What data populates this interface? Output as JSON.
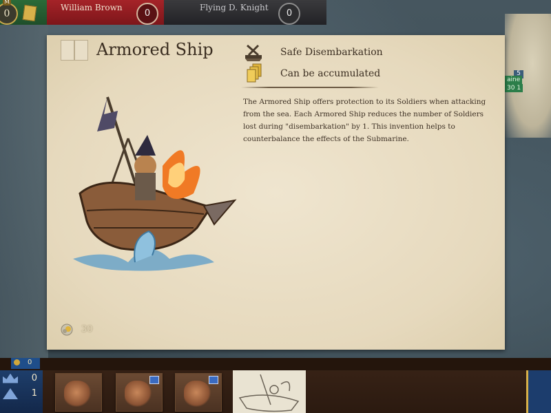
{
  "top_bar": {
    "resource_badge_letter": "M",
    "resource_count": "0",
    "players": [
      {
        "name": "William Brown",
        "score": "0",
        "color": "#a52328"
      },
      {
        "name": "Flying D. Knight",
        "score": "0",
        "color": "#2d2d2f"
      }
    ]
  },
  "map": {
    "region_name": "aine",
    "region_values": "30 1",
    "region_badge": "5"
  },
  "card": {
    "title": "Armored Ship",
    "abilities": [
      {
        "icon": "crossed-swords-icon",
        "label": "Safe Disembarkation"
      },
      {
        "icon": "stacked-cards-icon",
        "label": "Can be accumulated"
      }
    ],
    "description": "The Armored Ship offers protection to its Soldiers when attacking from the sea. Each Armored Ship reduces the number of Soldiers lost during \"disembarkation\" by 1. This invention helps to counterbalance the effects of the Submarine.",
    "cost_icon": "gear-coin-icon",
    "cost": "30"
  },
  "bottom_bar": {
    "top_tag_value": "0",
    "stats": [
      {
        "icon": "crown-icon",
        "value": "0"
      },
      {
        "icon": "soldier-icon",
        "value": "1"
      }
    ],
    "hand_cards": [
      {
        "name": "hand-card-1"
      },
      {
        "name": "hand-card-2"
      },
      {
        "name": "hand-card-3"
      }
    ]
  },
  "colors": {
    "parchment": "#e6d9bd",
    "text_dark": "#3a2d20",
    "player_red": "#a52328",
    "player_blue": "#1f4e8a"
  }
}
